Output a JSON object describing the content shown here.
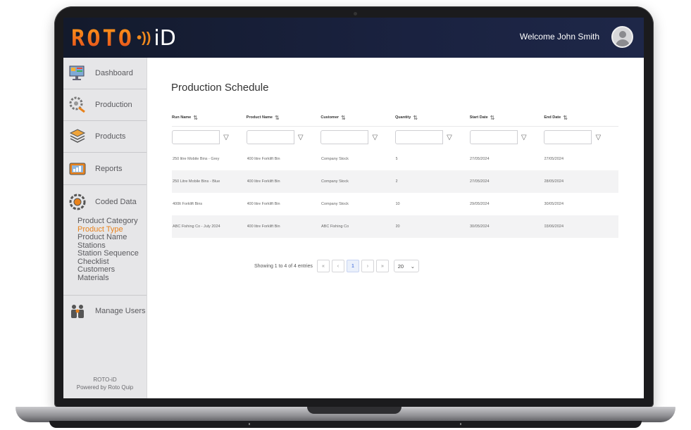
{
  "header": {
    "logo_roto": "ROTO",
    "logo_id": "iD",
    "welcome": "Welcome John Smith"
  },
  "sidebar": {
    "items": [
      {
        "label": "Dashboard",
        "icon": "dashboard-icon"
      },
      {
        "label": "Production",
        "icon": "production-icon"
      },
      {
        "label": "Products",
        "icon": "products-icon"
      },
      {
        "label": "Reports",
        "icon": "reports-icon"
      },
      {
        "label": "Coded Data",
        "icon": "coded-data-icon"
      }
    ],
    "sub_items": [
      "Product Category",
      "Product Type",
      "Product Name",
      "Stations",
      "Station Sequence",
      "Checklist",
      "Customers",
      "Materials"
    ],
    "active_sub_item": "Product Type",
    "manage_users": "Manage Users",
    "footer_line1": "ROTO-iD",
    "footer_line2": "Powered by Roto Quip"
  },
  "main": {
    "title": "Production Schedule",
    "columns": [
      "Run Name",
      "Product Name",
      "Customer",
      "Quantity",
      "Start Date",
      "End Date"
    ],
    "rows": [
      [
        "250 litre Mobile Bins - Grey",
        "400 litre Forklift Bin",
        "Company Stock",
        "5",
        "27/05/2024",
        "27/05/2024"
      ],
      [
        "250 Litre Mobile Bins - Blue",
        "400 litre Forklift Bin",
        "Company Stock",
        "2",
        "27/05/2024",
        "28/05/2024"
      ],
      [
        "400lt Forklift Bins",
        "400 litre Forklift Bin",
        "Company Stock",
        "10",
        "29/05/2024",
        "30/05/2024"
      ],
      [
        "ABC Fishing Co - July 2024",
        "400 litre Forklift Bin",
        "ABC Fishing Co",
        "20",
        "30/05/2024",
        "03/06/2024"
      ]
    ],
    "pagination": {
      "info": "Showing 1 to 4 of 4 entries",
      "first": "«",
      "prev": "‹",
      "current": "1",
      "next": "›",
      "last": "»",
      "page_size": "20"
    }
  },
  "colors": {
    "header_bg": "#131a2c",
    "accent": "#e8821c",
    "sidebar_bg": "#e6e6e8"
  }
}
